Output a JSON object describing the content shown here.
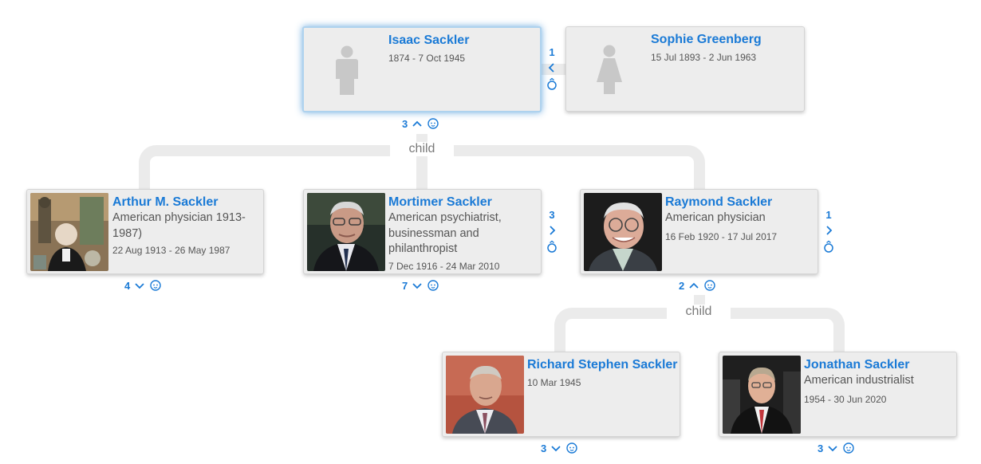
{
  "relation_label": "child",
  "people": {
    "isaac": {
      "name": "Isaac Sackler",
      "dates": "1874 - 7 Oct 1945",
      "children_count": "3",
      "spouses_count": "1",
      "gender_icon": "male-placeholder-icon"
    },
    "sophie": {
      "name": "Sophie Greenberg",
      "dates": "15 Jul 1893 - 2 Jun 1963",
      "gender_icon": "female-placeholder-icon"
    },
    "arthur": {
      "name": "Arthur M. Sackler",
      "description": "American physician 1913-1987)",
      "dates": "22 Aug 1913 - 26 May 1987",
      "children_count": "4"
    },
    "mortimer": {
      "name": "Mortimer Sackler",
      "description": "American psychiatrist, businessman and philanthropist",
      "dates": "7 Dec 1916 - 24 Mar 2010",
      "children_count": "7",
      "spouses_count": "3"
    },
    "raymond": {
      "name": "Raymond Sackler",
      "description": "American physician",
      "dates": "16 Feb 1920 - 17 Jul 2017",
      "children_count": "2",
      "spouses_count": "1"
    },
    "richard": {
      "name": "Richard Stephen Sackler",
      "dates": "10 Mar 1945",
      "children_count": "3"
    },
    "jonathan": {
      "name": "Jonathan Sackler",
      "description": "American industrialist",
      "dates": "1954 - 30 Jun 2020",
      "children_count": "3"
    }
  },
  "colors": {
    "link": "#1a7ad6",
    "card_bg": "#ededed",
    "connector": "#ebebeb",
    "selected_glow": "#aed2ee"
  }
}
